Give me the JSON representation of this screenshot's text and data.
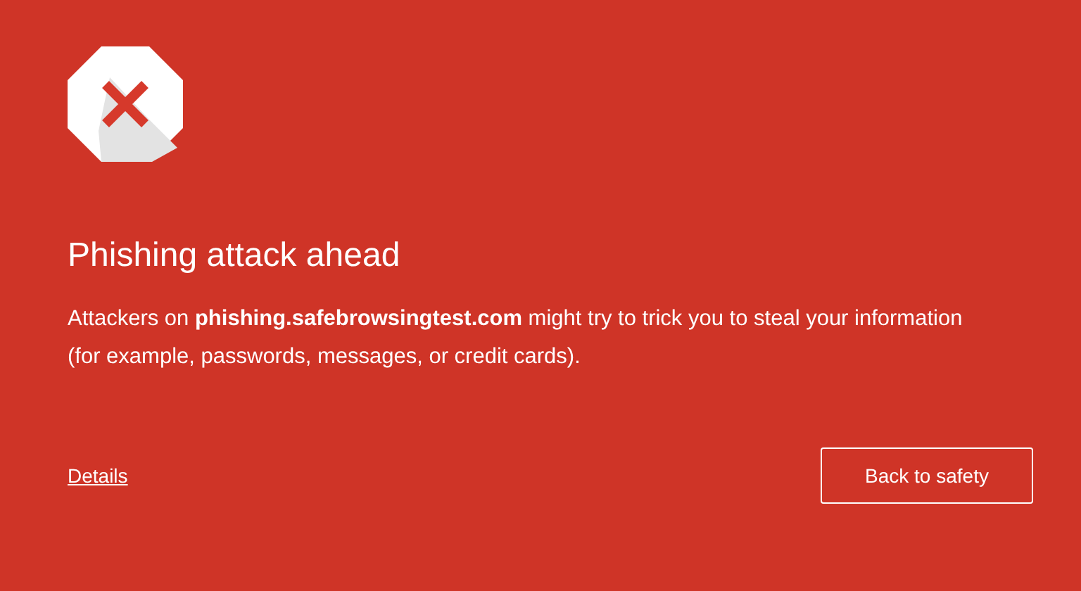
{
  "heading": "Phishing attack ahead",
  "message": "Attackers on **phishing.safebrowsingtest.com** might try to trick you to steal your information (for example, passwords, messages, or credit cards).",
  "details_link": "Details",
  "primary_button": "Back to safety"
}
